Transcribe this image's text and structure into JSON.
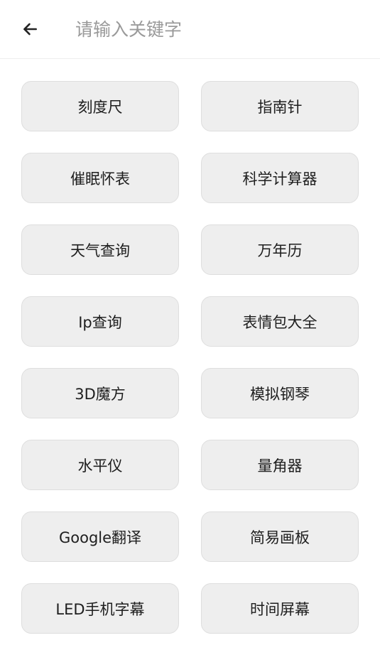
{
  "header": {
    "back_icon": "arrow-left-icon",
    "search_placeholder": "请输入关键字",
    "search_value": ""
  },
  "tools": [
    {
      "label": "刻度尺"
    },
    {
      "label": "指南针"
    },
    {
      "label": "催眠怀表"
    },
    {
      "label": "科学计算器"
    },
    {
      "label": "天气查询"
    },
    {
      "label": "万年历"
    },
    {
      "label": "Ip查询"
    },
    {
      "label": "表情包大全"
    },
    {
      "label": "3D魔方"
    },
    {
      "label": "模拟钢琴"
    },
    {
      "label": "水平仪"
    },
    {
      "label": "量角器"
    },
    {
      "label": "Google翻译"
    },
    {
      "label": "简易画板"
    },
    {
      "label": "LED手机字幕"
    },
    {
      "label": "时间屏幕"
    }
  ],
  "colors": {
    "button_bg": "#eeeeee",
    "button_border": "#dedede",
    "text": "#1e1e1e",
    "placeholder": "#9a9a9a"
  }
}
